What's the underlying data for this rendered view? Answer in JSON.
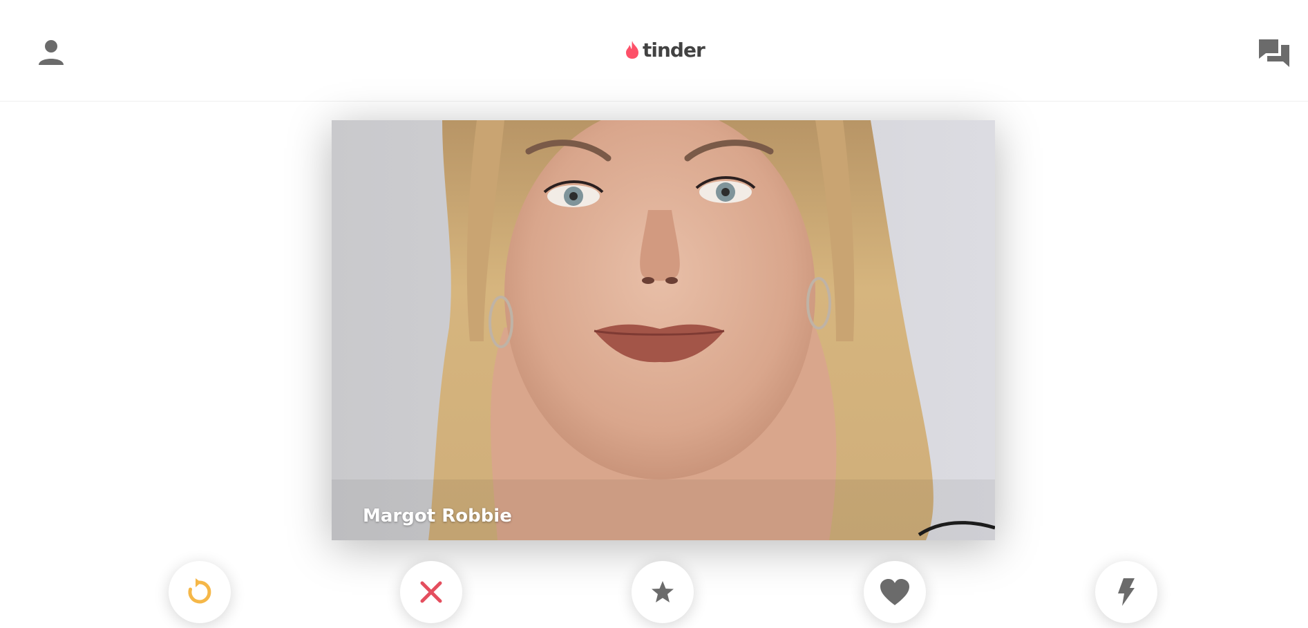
{
  "header": {
    "logo_text": "tinder",
    "profile_icon": "person-icon",
    "messages_icon": "chat-bubbles-icon"
  },
  "card": {
    "name": "Margot Robbie",
    "photo": "portrait-photo"
  },
  "actions": [
    {
      "id": "rewind",
      "icon": "rewind-icon",
      "color": "#f5b748"
    },
    {
      "id": "nope",
      "icon": "close-icon",
      "color": "#e44e5e"
    },
    {
      "id": "super-like",
      "icon": "star-icon",
      "color": "#6b6b6b"
    },
    {
      "id": "like",
      "icon": "heart-icon",
      "color": "#6b6b6b"
    },
    {
      "id": "boost",
      "icon": "lightning-icon",
      "color": "#6b6b6b"
    }
  ],
  "colors": {
    "brand": "#fd5068",
    "icon_gray": "#6b6b6b",
    "rewind": "#f5b748",
    "nope": "#e44e5e"
  }
}
